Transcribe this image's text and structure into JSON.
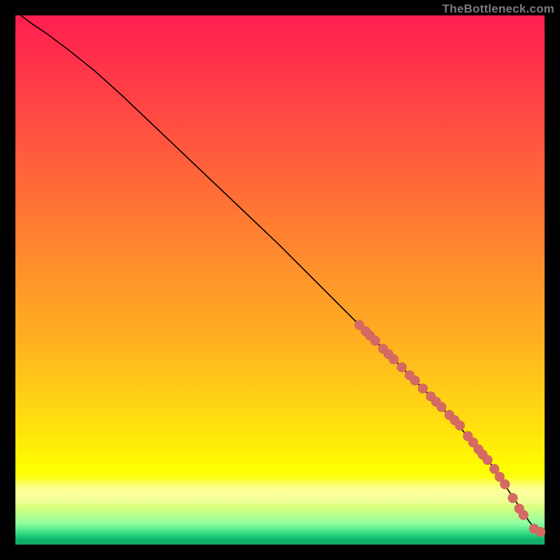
{
  "watermark": "TheBottleneck.com",
  "colors": {
    "dot": "#d46a63",
    "curve": "#000000"
  },
  "chart_data": {
    "type": "line",
    "title": "",
    "xlabel": "",
    "ylabel": "",
    "xlim": [
      0,
      100
    ],
    "ylim": [
      0,
      100
    ],
    "grid": false,
    "series": [
      {
        "name": "curve",
        "x": [
          1,
          3,
          6,
          10,
          15,
          20,
          30,
          40,
          50,
          60,
          65,
          70,
          75,
          80,
          85,
          88,
          90,
          92,
          94,
          96,
          97,
          98,
          99,
          99.5
        ],
        "y": [
          100,
          98.5,
          96.5,
          93.5,
          89.5,
          85,
          75.5,
          66,
          56.5,
          46.5,
          41.5,
          36.5,
          31.5,
          26.5,
          21,
          17.5,
          15,
          12,
          9,
          6,
          4.5,
          3.2,
          2.5,
          2.3
        ]
      }
    ],
    "scatter": [
      {
        "x": 65.0,
        "y": 41.5
      },
      {
        "x": 66.2,
        "y": 40.3
      },
      {
        "x": 67.0,
        "y": 39.5
      },
      {
        "x": 68.0,
        "y": 38.5
      },
      {
        "x": 69.5,
        "y": 37.0
      },
      {
        "x": 70.5,
        "y": 36.0
      },
      {
        "x": 71.5,
        "y": 35.0
      },
      {
        "x": 73.0,
        "y": 33.5
      },
      {
        "x": 74.5,
        "y": 32.0
      },
      {
        "x": 75.5,
        "y": 31.0
      },
      {
        "x": 77.0,
        "y": 29.5
      },
      {
        "x": 78.5,
        "y": 28.0
      },
      {
        "x": 79.5,
        "y": 27.0
      },
      {
        "x": 80.5,
        "y": 26.0
      },
      {
        "x": 82.0,
        "y": 24.5
      },
      {
        "x": 83.0,
        "y": 23.5
      },
      {
        "x": 84.0,
        "y": 22.5
      },
      {
        "x": 85.5,
        "y": 20.5
      },
      {
        "x": 86.5,
        "y": 19.3
      },
      {
        "x": 87.5,
        "y": 18.0
      },
      {
        "x": 88.3,
        "y": 17.0
      },
      {
        "x": 89.2,
        "y": 16.0
      },
      {
        "x": 90.5,
        "y": 14.3
      },
      {
        "x": 91.5,
        "y": 12.8
      },
      {
        "x": 92.5,
        "y": 11.4
      },
      {
        "x": 94.0,
        "y": 8.8
      },
      {
        "x": 95.2,
        "y": 6.8
      },
      {
        "x": 96.0,
        "y": 5.6
      },
      {
        "x": 98.0,
        "y": 3.0
      },
      {
        "x": 99.2,
        "y": 2.4
      }
    ]
  }
}
